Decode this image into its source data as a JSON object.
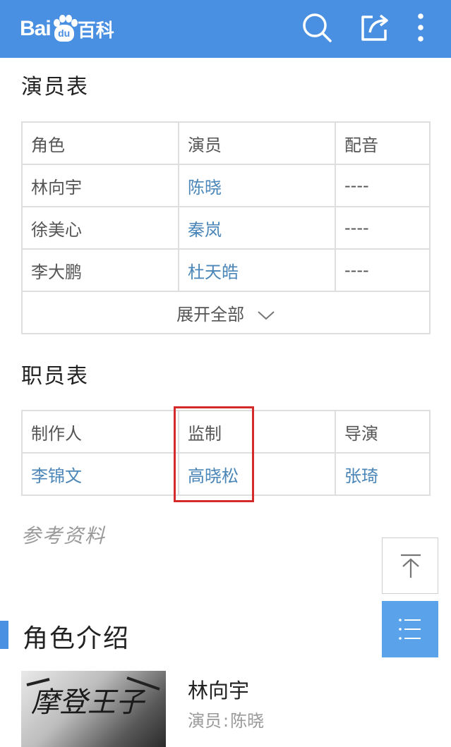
{
  "header": {
    "logo_bai": "Bai",
    "logo_du": "du",
    "logo_baike": "百科",
    "icons": [
      "search-icon",
      "share-icon",
      "more-vertical-icon"
    ]
  },
  "cast": {
    "title": "演员表",
    "columns": [
      "角色",
      "演员",
      "配音"
    ],
    "rows": [
      [
        "林向宇",
        "陈晓",
        "----"
      ],
      [
        "徐美心",
        "秦岚",
        "----"
      ],
      [
        "李大鹏",
        "杜天皓",
        "----"
      ]
    ],
    "expand_label": "展开全部"
  },
  "staff": {
    "title": "职员表",
    "columns": [
      "制作人",
      "监制",
      "导演"
    ],
    "values": [
      "李锦文",
      "高晓松",
      "张琦"
    ]
  },
  "references": {
    "label": "参考资料"
  },
  "role_intro": {
    "title": "角色介绍",
    "name": "林向宇",
    "actor_label": "演员",
    "actor_sep": ":",
    "actor_name": "陈晓",
    "thumb_text": "摩登王子"
  },
  "colors": {
    "brand": "#4a90e2",
    "link": "#4b86b8",
    "highlight": "#d52a2a",
    "list_button": "#5aa3ea"
  }
}
